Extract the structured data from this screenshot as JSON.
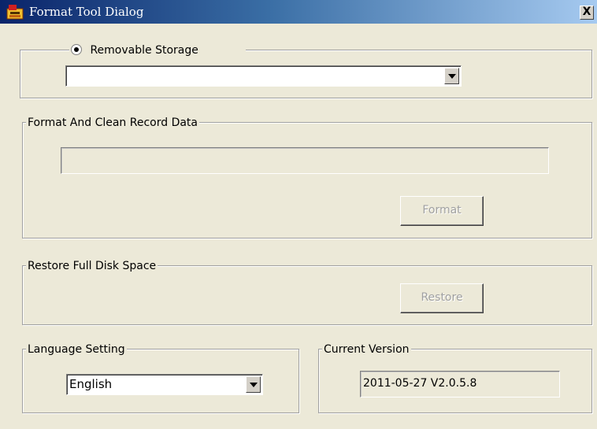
{
  "window": {
    "title": "Format Tool Dialog",
    "close_label": "X"
  },
  "storage": {
    "radio_label": "Removable Storage",
    "radio_checked": true,
    "device_selected": ""
  },
  "format_section": {
    "label": "Format And Clean Record Data",
    "progress_text": "",
    "button_label": "Format"
  },
  "restore_section": {
    "label": "Restore Full Disk Space",
    "button_label": "Restore"
  },
  "language": {
    "label": "Language Setting",
    "selected": "English"
  },
  "version": {
    "label": "Current Version",
    "value": "2011-05-27 V2.0.5.8"
  }
}
